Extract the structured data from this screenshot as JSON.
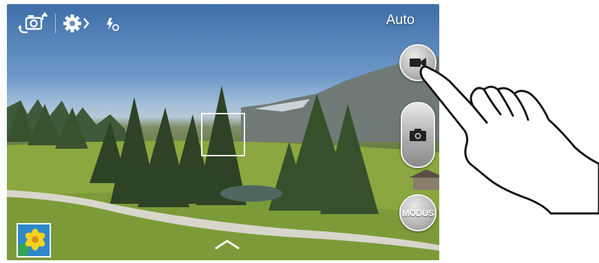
{
  "camera": {
    "mode_label": "Auto",
    "shooting_mode_button_label": "MODUS",
    "icons": {
      "switch_camera": "switch-camera-icon",
      "settings": "gear-icon",
      "flash": "flash-auto-icon",
      "record": "video-camera-icon",
      "shutter": "camera-icon",
      "gallery": "gallery-thumbnail",
      "expand": "chevron-up-icon"
    }
  },
  "colors": {
    "overlay_text": "#ffffff",
    "button_gray": "#b9b9b9",
    "focus_box": "#ffffff"
  }
}
